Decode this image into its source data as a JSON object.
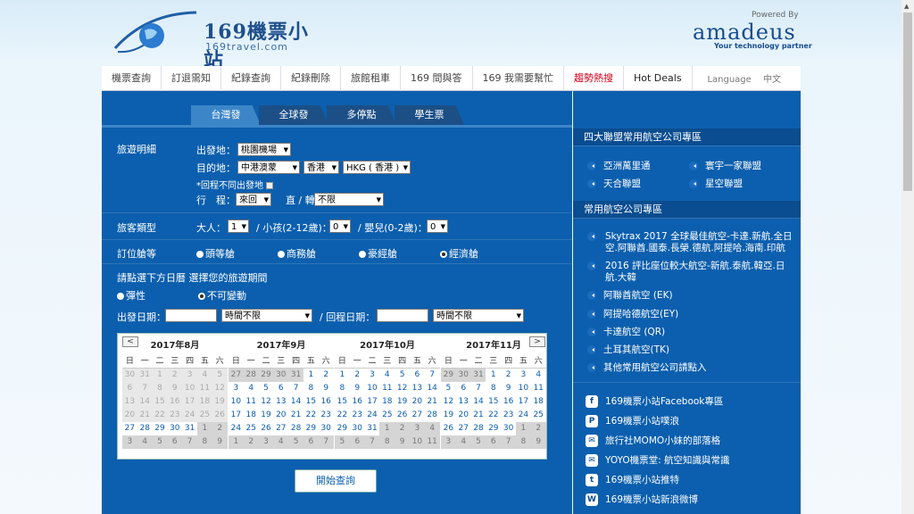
{
  "logo": {
    "title": "169機票小站",
    "subtitle": "169travel.com"
  },
  "partner": {
    "powered": "Powered By",
    "name": "amadeus",
    "tagline": "Your technology partner"
  },
  "nav": {
    "items": [
      "機票查詢",
      "訂退需知",
      "紀錄查詢",
      "紀錄刪除",
      "旅館租車",
      "169 問與答",
      "169 我需要幫忙",
      "趨勢熱搜",
      "Hot Deals"
    ],
    "language_label": "Language",
    "language_value": "中文"
  },
  "tabs": [
    "台灣發",
    "全球發",
    "多停點",
    "學生票"
  ],
  "form": {
    "trip_section": "旅遊明細",
    "depart_label": "出發地：",
    "depart_value": "桃園機場",
    "dest_label": "目的地：",
    "dest_region": "中港澳蒙",
    "dest_country": "香港",
    "dest_city": "HKG ( 香港 )",
    "return_diff": "*回程不同出發地",
    "itinerary_label": "行　程：",
    "itinerary_value": "來回",
    "direct_label": "直 / 轉",
    "direct_value": "不限",
    "pax_section": "旅客類型",
    "adult_label": "大人：",
    "adult_value": "1",
    "child_label": "/ 小孩(2-12歲)：",
    "child_value": "0",
    "infant_label": "/ 嬰兒(0-2歲)：",
    "infant_value": "0",
    "class_section": "訂位艙等",
    "classes": [
      "頭等艙",
      "商務艙",
      "豪經艙",
      "經濟艙"
    ],
    "date_prompt": "請點選下方日曆 選擇您的旅遊期間",
    "flexible": "彈性",
    "fixed": "不可變動",
    "depart_date_label": "出發日期：",
    "time_any": "時間不限",
    "return_date_label": "/ 回程日期：",
    "search_button": "開始查詢"
  },
  "calendar": {
    "prev": "<",
    "next": ">",
    "dow": [
      "日",
      "一",
      "二",
      "三",
      "四",
      "五",
      "六"
    ],
    "months": [
      {
        "title": "2017年8月",
        "weeks": [
          [
            [
              "30",
              "off"
            ],
            [
              "31",
              "off"
            ],
            [
              "1",
              "off"
            ],
            [
              "2",
              "off"
            ],
            [
              "3",
              "off"
            ],
            [
              "4",
              "off"
            ],
            [
              "5",
              "off"
            ]
          ],
          [
            [
              "6",
              "off"
            ],
            [
              "7",
              "off"
            ],
            [
              "8",
              "off"
            ],
            [
              "9",
              "off"
            ],
            [
              "10",
              "off"
            ],
            [
              "11",
              "off"
            ],
            [
              "12",
              "off"
            ]
          ],
          [
            [
              "13",
              "off"
            ],
            [
              "14",
              "off"
            ],
            [
              "15",
              "off"
            ],
            [
              "16",
              "off"
            ],
            [
              "17",
              "off"
            ],
            [
              "18",
              "off"
            ],
            [
              "19",
              "off"
            ]
          ],
          [
            [
              "20",
              "off"
            ],
            [
              "21",
              "off"
            ],
            [
              "22",
              "off"
            ],
            [
              "23",
              "off"
            ],
            [
              "24",
              "off"
            ],
            [
              "25",
              "off"
            ],
            [
              "26",
              "off"
            ]
          ],
          [
            [
              "27",
              ""
            ],
            [
              "28",
              ""
            ],
            [
              "29",
              ""
            ],
            [
              "30",
              ""
            ],
            [
              "31",
              ""
            ],
            [
              "1",
              "out"
            ],
            [
              "2",
              "out"
            ]
          ],
          [
            [
              "3",
              "out"
            ],
            [
              "4",
              "out"
            ],
            [
              "5",
              "out"
            ],
            [
              "6",
              "out"
            ],
            [
              "7",
              "out"
            ],
            [
              "8",
              "out"
            ],
            [
              "9",
              "out"
            ]
          ]
        ]
      },
      {
        "title": "2017年9月",
        "weeks": [
          [
            [
              "27",
              "out"
            ],
            [
              "28",
              "out"
            ],
            [
              "29",
              "out"
            ],
            [
              "30",
              "out"
            ],
            [
              "31",
              "out"
            ],
            [
              "1",
              ""
            ],
            [
              "2",
              ""
            ]
          ],
          [
            [
              "3",
              ""
            ],
            [
              "4",
              ""
            ],
            [
              "5",
              ""
            ],
            [
              "6",
              ""
            ],
            [
              "7",
              ""
            ],
            [
              "8",
              ""
            ],
            [
              "9",
              ""
            ]
          ],
          [
            [
              "10",
              ""
            ],
            [
              "11",
              ""
            ],
            [
              "12",
              ""
            ],
            [
              "13",
              ""
            ],
            [
              "14",
              ""
            ],
            [
              "15",
              ""
            ],
            [
              "16",
              ""
            ]
          ],
          [
            [
              "17",
              ""
            ],
            [
              "18",
              ""
            ],
            [
              "19",
              ""
            ],
            [
              "20",
              ""
            ],
            [
              "21",
              ""
            ],
            [
              "22",
              ""
            ],
            [
              "23",
              ""
            ]
          ],
          [
            [
              "24",
              ""
            ],
            [
              "25",
              ""
            ],
            [
              "26",
              ""
            ],
            [
              "27",
              ""
            ],
            [
              "28",
              ""
            ],
            [
              "29",
              ""
            ],
            [
              "30",
              ""
            ]
          ],
          [
            [
              "1",
              "out"
            ],
            [
              "2",
              "out"
            ],
            [
              "3",
              "out"
            ],
            [
              "4",
              "out"
            ],
            [
              "5",
              "out"
            ],
            [
              "6",
              "out"
            ],
            [
              "7",
              "out"
            ]
          ]
        ]
      },
      {
        "title": "2017年10月",
        "weeks": [
          [
            [
              "1",
              ""
            ],
            [
              "2",
              ""
            ],
            [
              "3",
              ""
            ],
            [
              "4",
              ""
            ],
            [
              "5",
              ""
            ],
            [
              "6",
              ""
            ],
            [
              "7",
              ""
            ]
          ],
          [
            [
              "8",
              ""
            ],
            [
              "9",
              ""
            ],
            [
              "10",
              ""
            ],
            [
              "11",
              ""
            ],
            [
              "12",
              ""
            ],
            [
              "13",
              ""
            ],
            [
              "14",
              ""
            ]
          ],
          [
            [
              "15",
              ""
            ],
            [
              "16",
              ""
            ],
            [
              "17",
              ""
            ],
            [
              "18",
              ""
            ],
            [
              "19",
              ""
            ],
            [
              "20",
              ""
            ],
            [
              "21",
              ""
            ]
          ],
          [
            [
              "22",
              ""
            ],
            [
              "23",
              ""
            ],
            [
              "24",
              ""
            ],
            [
              "25",
              ""
            ],
            [
              "26",
              ""
            ],
            [
              "27",
              ""
            ],
            [
              "28",
              ""
            ]
          ],
          [
            [
              "29",
              ""
            ],
            [
              "30",
              ""
            ],
            [
              "31",
              ""
            ],
            [
              "1",
              "out"
            ],
            [
              "2",
              "out"
            ],
            [
              "3",
              "out"
            ],
            [
              "4",
              "out"
            ]
          ],
          [
            [
              "5",
              "out"
            ],
            [
              "6",
              "out"
            ],
            [
              "7",
              "out"
            ],
            [
              "8",
              "out"
            ],
            [
              "9",
              "out"
            ],
            [
              "10",
              "out"
            ],
            [
              "11",
              "out"
            ]
          ]
        ]
      },
      {
        "title": "2017年11月",
        "weeks": [
          [
            [
              "29",
              "out"
            ],
            [
              "30",
              "out"
            ],
            [
              "31",
              "out"
            ],
            [
              "1",
              ""
            ],
            [
              "2",
              ""
            ],
            [
              "3",
              ""
            ],
            [
              "4",
              ""
            ]
          ],
          [
            [
              "5",
              ""
            ],
            [
              "6",
              ""
            ],
            [
              "7",
              ""
            ],
            [
              "8",
              ""
            ],
            [
              "9",
              ""
            ],
            [
              "10",
              ""
            ],
            [
              "11",
              ""
            ]
          ],
          [
            [
              "12",
              ""
            ],
            [
              "13",
              ""
            ],
            [
              "14",
              ""
            ],
            [
              "15",
              ""
            ],
            [
              "16",
              ""
            ],
            [
              "17",
              ""
            ],
            [
              "18",
              ""
            ]
          ],
          [
            [
              "19",
              ""
            ],
            [
              "20",
              ""
            ],
            [
              "21",
              ""
            ],
            [
              "22",
              ""
            ],
            [
              "23",
              ""
            ],
            [
              "24",
              ""
            ],
            [
              "25",
              ""
            ]
          ],
          [
            [
              "26",
              ""
            ],
            [
              "27",
              ""
            ],
            [
              "28",
              ""
            ],
            [
              "29",
              ""
            ],
            [
              "30",
              ""
            ],
            [
              "1",
              "out"
            ],
            [
              "2",
              "out"
            ]
          ],
          [
            [
              "3",
              "out"
            ],
            [
              "4",
              "out"
            ],
            [
              "5",
              "out"
            ],
            [
              "6",
              "out"
            ],
            [
              "7",
              "out"
            ],
            [
              "8",
              "out"
            ],
            [
              "9",
              "out"
            ]
          ]
        ]
      }
    ]
  },
  "right": {
    "alliance_title": "四大聯盟常用航空公司專區",
    "alliances": [
      "亞洲萬里通",
      "寰宇一家聯盟",
      "天合聯盟",
      "星空聯盟"
    ],
    "airline_title": "常用航空公司專區",
    "airline_long": [
      "Skytrax 2017 全球最佳航空-卡達.新航.全日空.阿聯酋.國泰.長榮.德航.阿提哈.海南.印航",
      "2016 評比座位較大航空-新航.泰航.韓亞.日航.大韓"
    ],
    "airlines": [
      "阿聯酋航空 (EK)",
      "阿提哈德航空(EY)",
      "卡達航空 (QR)",
      "土耳其航空(TK)",
      "其他常用航空公司請點入"
    ],
    "social": [
      {
        "icon": "facebook-icon",
        "glyph": "f",
        "label": "169機票小站Facebook專區"
      },
      {
        "icon": "plurk-icon",
        "glyph": "P",
        "label": "169機票小站噗浪"
      },
      {
        "icon": "blog-icon",
        "glyph": "✉",
        "label": "旅行社MOMO小妹的部落格"
      },
      {
        "icon": "blog-icon",
        "glyph": "✉",
        "label": "YOYO機票堂: 航空知識與常識"
      },
      {
        "icon": "twitter-icon",
        "glyph": "t",
        "label": "169機票小站推特"
      },
      {
        "icon": "weibo-icon",
        "glyph": "W",
        "label": "169機票小站新浪微博"
      }
    ]
  }
}
